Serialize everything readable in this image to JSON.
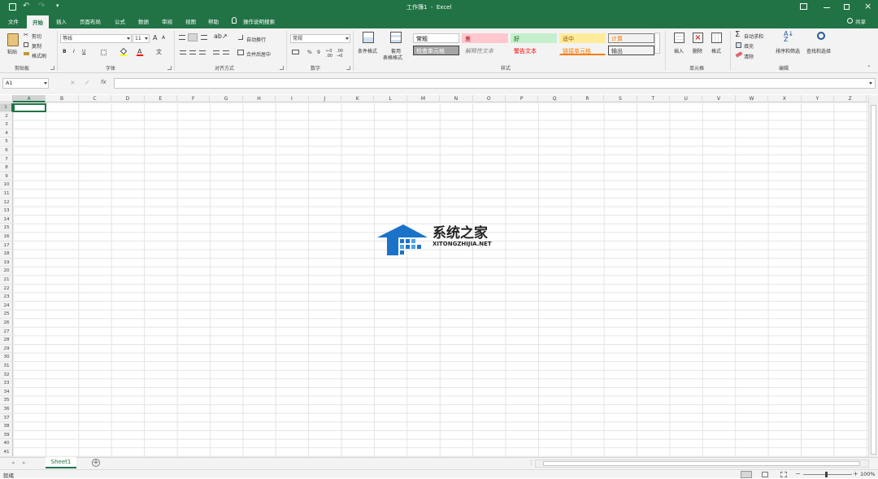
{
  "titlebar": {
    "title": "工作簿1  -  Excel"
  },
  "tabs": [
    "文件",
    "开始",
    "插入",
    "页面布局",
    "公式",
    "数据",
    "审阅",
    "视图",
    "帮助",
    "操作说明搜索"
  ],
  "share_label": "共享",
  "ribbon": {
    "clipboard": {
      "paste": "粘贴",
      "cut": "剪切",
      "copy": "复制",
      "format_painter": "格式刷",
      "label": "剪贴板"
    },
    "font": {
      "font_name": "等线",
      "font_size": "11",
      "bold": "B",
      "italic": "I",
      "underline": "U",
      "font_color_glyph": "A",
      "grow_glyph": "A",
      "shrink_glyph": "A",
      "label": "字体"
    },
    "alignment": {
      "wrap_text": "自动换行",
      "merge_center": "合并后居中",
      "label": "对齐方式"
    },
    "number": {
      "format": "常规",
      "percent": "%",
      "comma": "9",
      "label": "数字"
    },
    "styles": {
      "conditional": "条件格式",
      "table_format_1": "套用",
      "table_format_2": "表格格式",
      "cells": [
        {
          "text": "常规",
          "bg": "#ffffff",
          "color": "#000000",
          "border": "#c6c6c6"
        },
        {
          "text": "差",
          "bg": "#ffc7ce",
          "color": "#9c0006",
          "border": "#ffc7ce"
        },
        {
          "text": "好",
          "bg": "#c6efce",
          "color": "#006100",
          "border": "#c6efce"
        },
        {
          "text": "适中",
          "bg": "#ffeb9c",
          "color": "#9c5700",
          "border": "#ffeb9c"
        },
        {
          "text": "计算",
          "bg": "#f2f2f2",
          "color": "#fa7d00",
          "border": "#7f7f7f"
        },
        {
          "text": "检查单元格",
          "bg": "#a5a5a5",
          "color": "#ffffff",
          "border": "#3f3f3f"
        },
        {
          "text": "解释性文本",
          "bg": "#f3f3f3",
          "color": "#7f7f7f",
          "border": "#f3f3f3"
        },
        {
          "text": "警告文本",
          "bg": "#f3f3f3",
          "color": "#ff0000",
          "border": "#f3f3f3"
        },
        {
          "text": "链接单元格",
          "bg": "#f3f3f3",
          "color": "#fa7d00",
          "border": "#f3f3f3"
        },
        {
          "text": "输出",
          "bg": "#f2f2f2",
          "color": "#3f3f3f",
          "border": "#3f3f3f"
        }
      ],
      "label": "样式"
    },
    "cells": {
      "insert": "插入",
      "delete": "删除",
      "format": "格式",
      "label": "单元格"
    },
    "editing": {
      "autosum": "自动求和",
      "fill": "填充",
      "clear": "清除",
      "sort": "排序和筛选",
      "find": "查找和选择",
      "label": "编辑"
    }
  },
  "namebox": "A1",
  "fx_label": "fx",
  "columns": [
    "A",
    "B",
    "C",
    "D",
    "E",
    "F",
    "G",
    "H",
    "I",
    "J",
    "K",
    "L",
    "M",
    "N",
    "O",
    "P",
    "Q",
    "R",
    "S",
    "T",
    "U",
    "V",
    "W",
    "X",
    "Y",
    "Z"
  ],
  "rows": [
    "1",
    "2",
    "3",
    "4",
    "5",
    "6",
    "7",
    "8",
    "9",
    "10",
    "11",
    "12",
    "13",
    "14",
    "15",
    "16",
    "17",
    "18",
    "19",
    "20",
    "21",
    "22",
    "23",
    "24",
    "25",
    "26",
    "27",
    "28",
    "29",
    "30",
    "31",
    "32",
    "33",
    "34",
    "35",
    "36",
    "37",
    "38",
    "39",
    "40",
    "41"
  ],
  "sheet_tab": "Sheet1",
  "status": {
    "ready": "就绪",
    "zoom": "100%"
  },
  "watermark": {
    "title": "系统之家",
    "url": "XITONGZHIJIA.NET"
  },
  "colors": {
    "brand": "#217346"
  }
}
